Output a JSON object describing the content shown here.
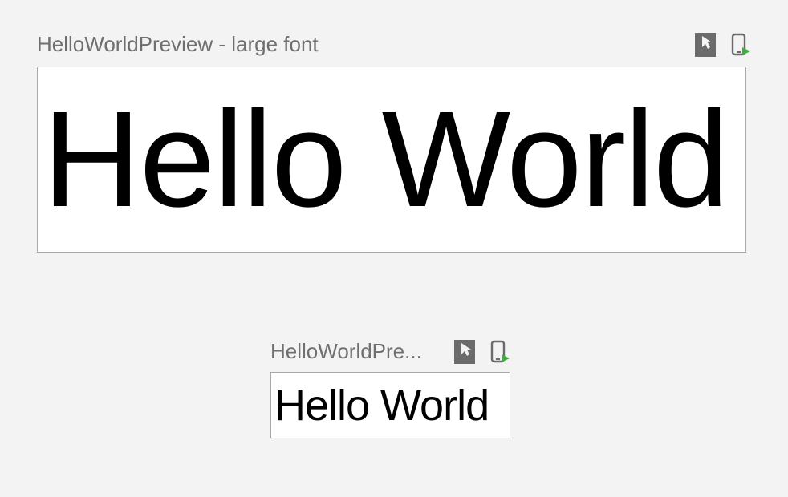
{
  "previews": [
    {
      "title": "HelloWorldPreview - large font",
      "content": "Hello World"
    },
    {
      "title": "HelloWorldPre...",
      "content": "Hello World"
    }
  ],
  "icons": {
    "interactive": "interactive-mode-icon",
    "deploy": "deploy-preview-icon"
  }
}
